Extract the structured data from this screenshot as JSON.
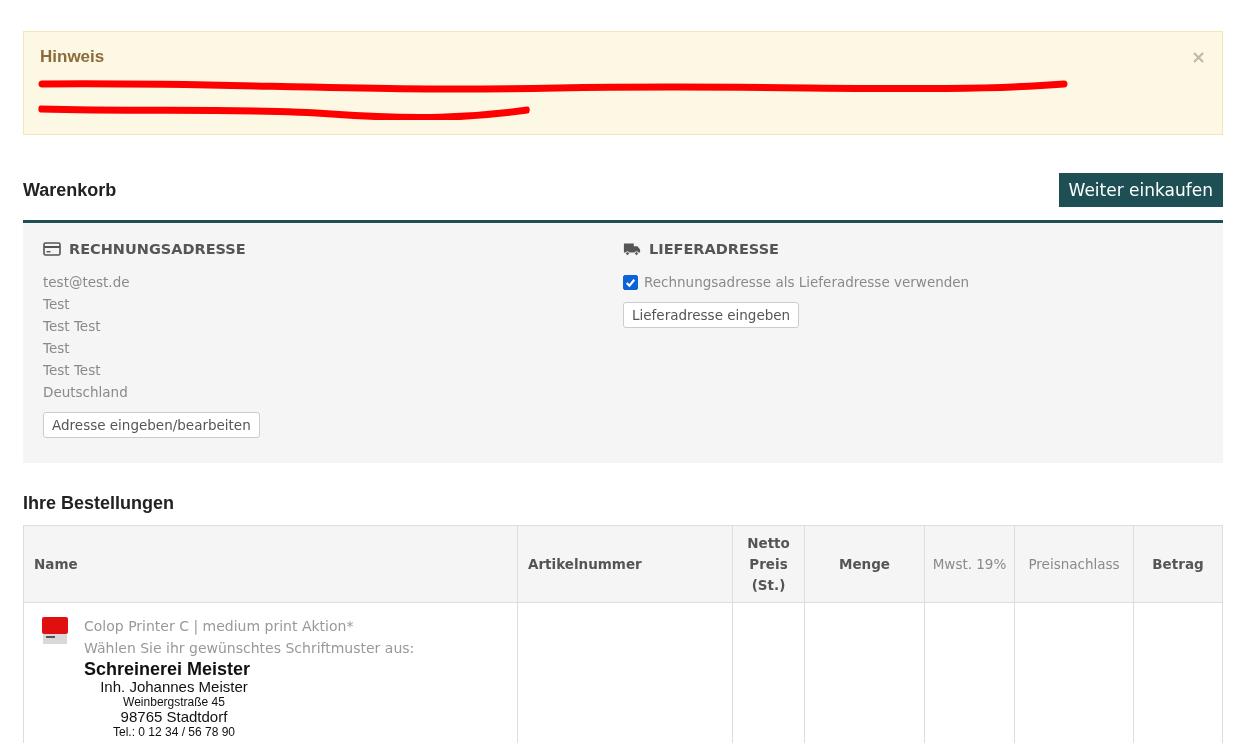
{
  "notice": {
    "title": "Hinweis",
    "close": "×"
  },
  "cart": {
    "title": "Warenkorb",
    "continue_button": "Weiter einkaufen"
  },
  "billing": {
    "title": "RECHNUNGSADRESSE",
    "lines": [
      "test@test.de",
      "Test",
      "Test Test",
      "Test",
      "Test Test",
      "Deutschland"
    ],
    "button": "Adresse eingeben/bearbeiten"
  },
  "shipping": {
    "title": "LIEFERADRESSE",
    "same_as_billing": {
      "label": "Rechnungsadresse als Lieferadresse verwenden",
      "checked": true
    },
    "button": "Lieferadresse eingeben"
  },
  "orders": {
    "title": "Ihre Bestellungen",
    "columns": [
      {
        "label": "Name",
        "muted": false
      },
      {
        "label": "Artikelnummer",
        "muted": false
      },
      {
        "label": "Netto Preis (St.)",
        "muted": false
      },
      {
        "label": "Menge",
        "muted": false
      },
      {
        "label": "Mwst. 19%",
        "muted": true
      },
      {
        "label": "Preisnachlass",
        "muted": true
      },
      {
        "label": "Betrag",
        "muted": false
      }
    ],
    "rows": [
      {
        "product": "Colop Printer C | medium print Aktion*",
        "prompt": "Wählen Sie ihr gewünschtes Schriftmuster aus:",
        "stamp_lines": [
          {
            "text": "Schreinerei Meister",
            "kind": "title"
          },
          {
            "text": "Inh. Johannes Meister",
            "kind": "large"
          },
          {
            "text": "Weinbergstraße 45",
            "kind": "small"
          },
          {
            "text": "98765 Stadtdorf",
            "kind": "large"
          },
          {
            "text": "Tel.: 0 12 34 / 56 78 90",
            "kind": "small"
          }
        ]
      }
    ]
  }
}
